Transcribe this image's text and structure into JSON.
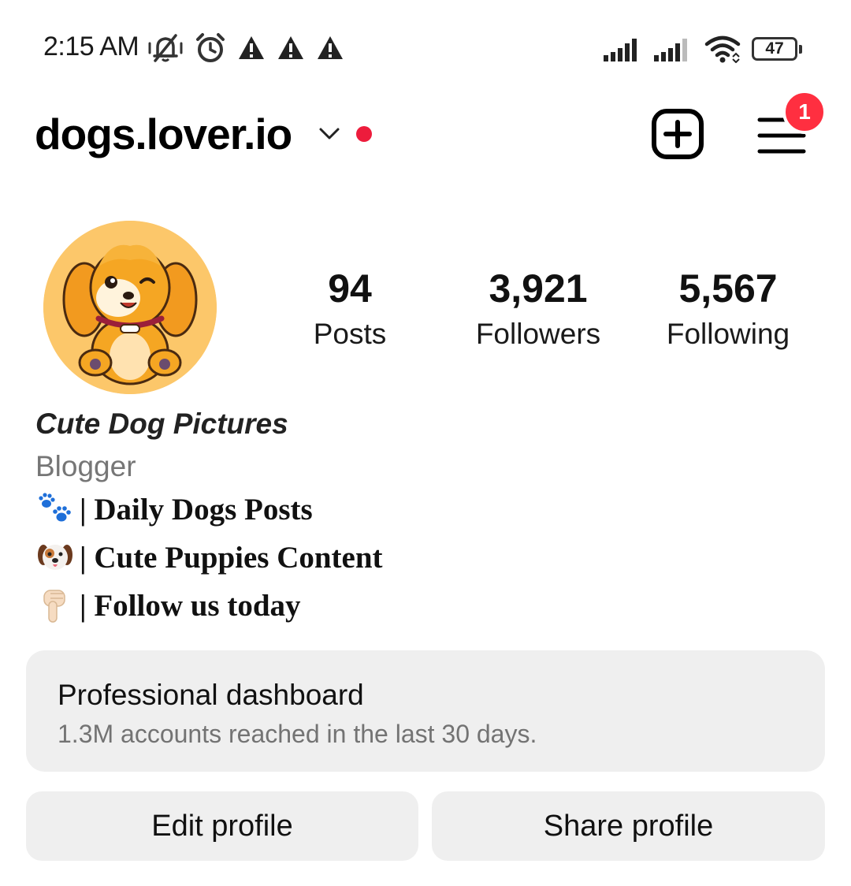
{
  "status_bar": {
    "time": "2:15 AM",
    "battery": "47",
    "left_icons": [
      "muted-bell-icon",
      "alarm-icon",
      "warning-icon",
      "warning-icon",
      "warning-icon"
    ],
    "right_icons": [
      "signal-icon",
      "signal-icon",
      "wifi-icon",
      "battery-icon"
    ]
  },
  "header": {
    "username": "dogs.lover.io",
    "notification_count": "1",
    "live_dot_color": "#ed1c3c"
  },
  "profile": {
    "stats": [
      {
        "value": "94",
        "label": "Posts"
      },
      {
        "value": "3,921",
        "label": "Followers"
      },
      {
        "value": "5,567",
        "label": "Following"
      }
    ],
    "display_name": "Cute Dog Pictures",
    "category": "Blogger",
    "bio": [
      {
        "emoji": "paw-prints-icon",
        "text": "| Daily Dogs Posts"
      },
      {
        "emoji": "dog-face-icon",
        "text": "| Cute Puppies Content"
      },
      {
        "emoji": "pointing-down-icon",
        "text": "| Follow us today"
      }
    ]
  },
  "dashboard": {
    "title": "Professional dashboard",
    "subtitle": "1.3M accounts reached in the last 30 days."
  },
  "actions": {
    "edit_label": "Edit profile",
    "share_label": "Share profile"
  },
  "colors": {
    "badge": "#ff2f40",
    "card_bg": "#efefef",
    "secondary_text": "#737373"
  }
}
